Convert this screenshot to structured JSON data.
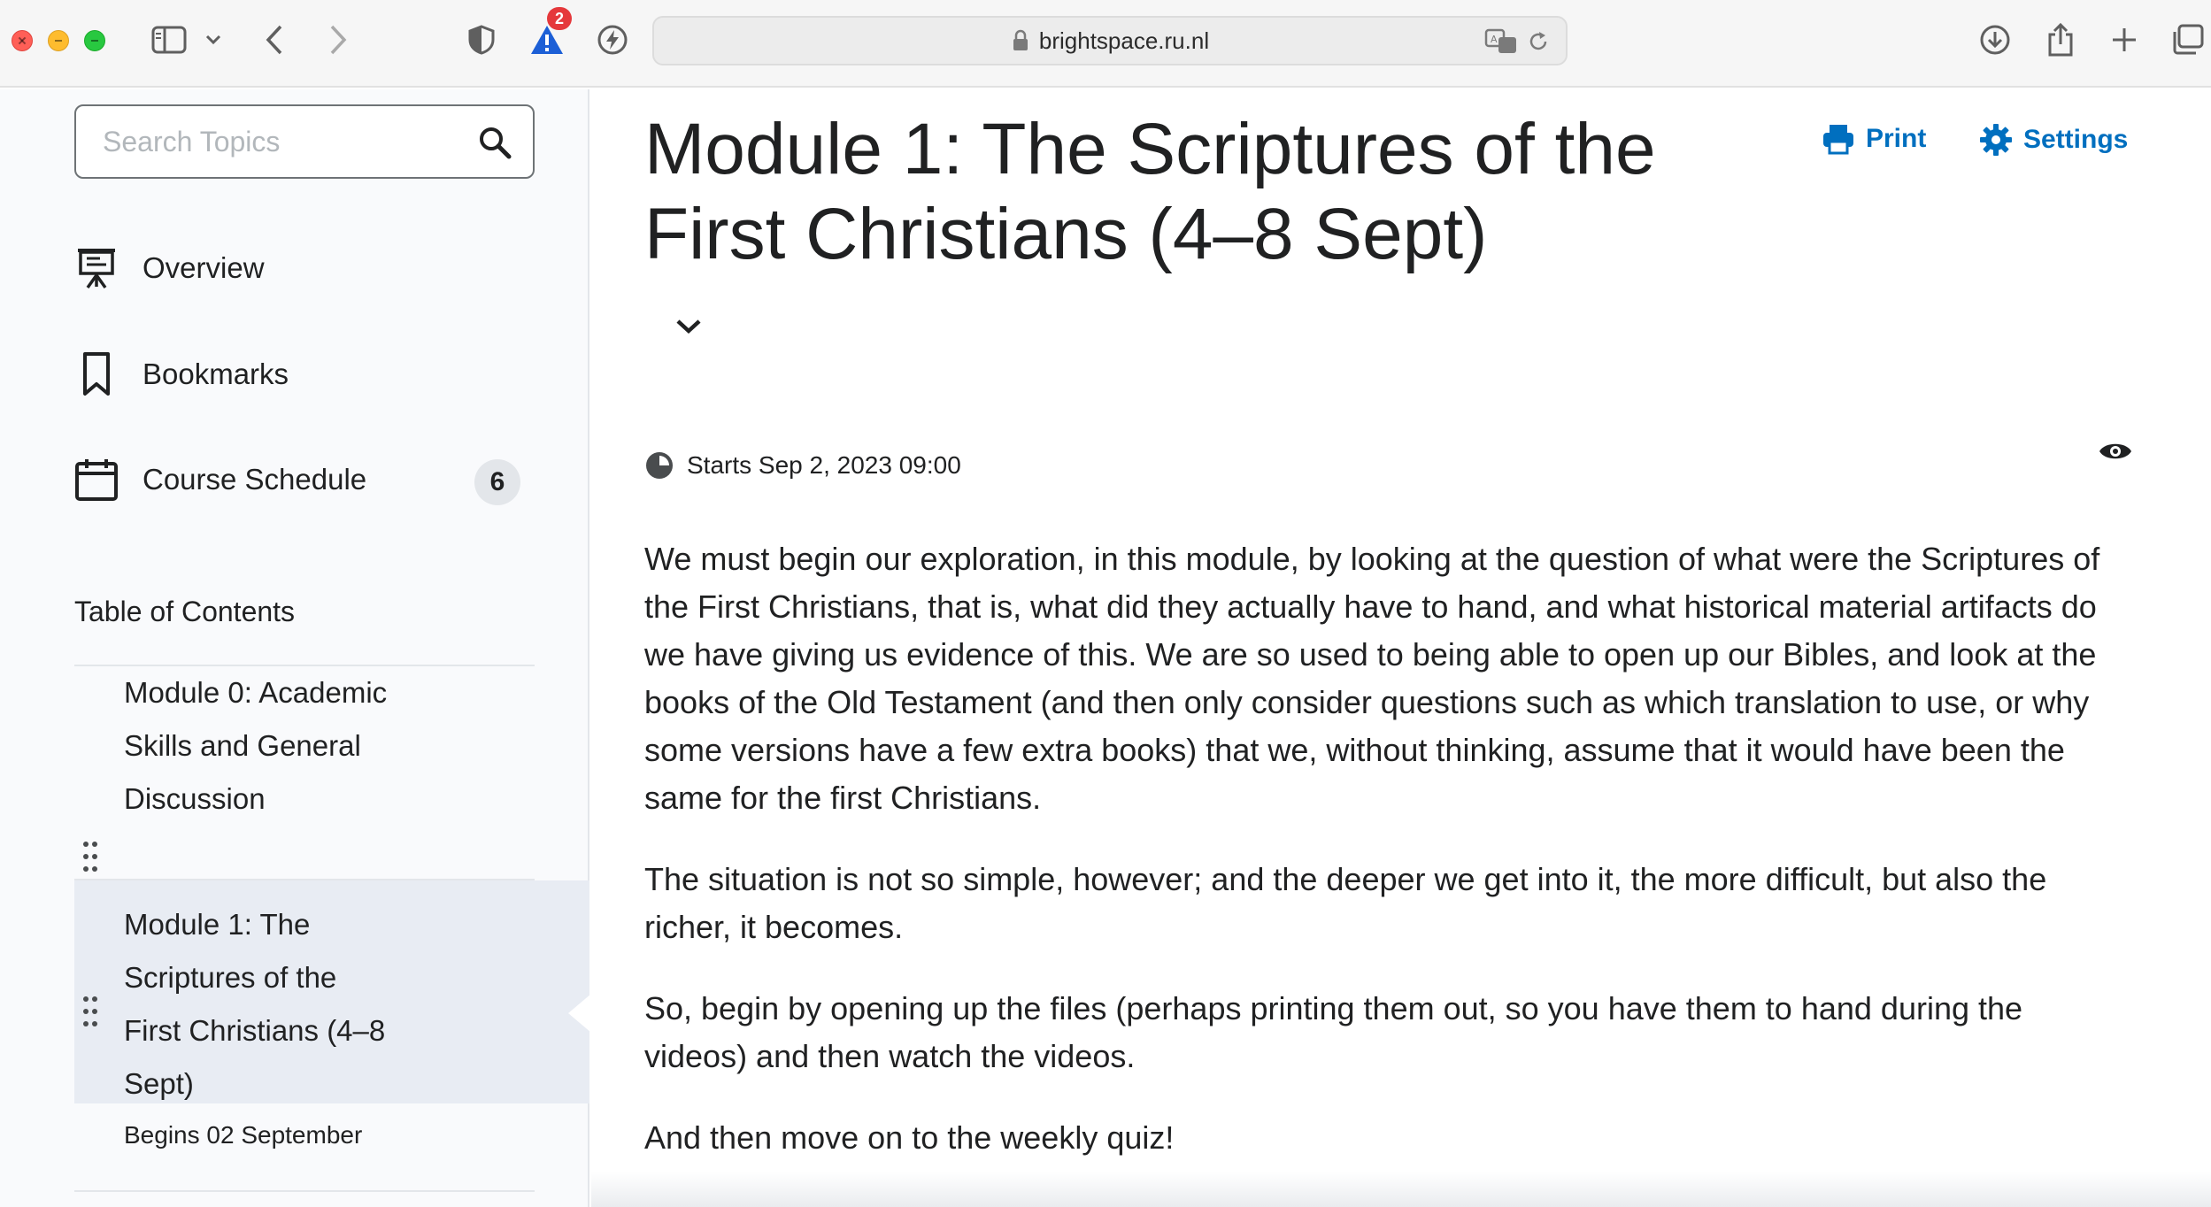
{
  "browser": {
    "url": "brightspace.ru.nl",
    "alert_badge_count": "2"
  },
  "sidebar": {
    "search_placeholder": "Search Topics",
    "nav": [
      {
        "label": "Overview",
        "icon": "presentation-icon"
      },
      {
        "label": "Bookmarks",
        "icon": "bookmark-icon"
      },
      {
        "label": "Course Schedule",
        "icon": "calendar-icon",
        "count": "6"
      }
    ],
    "toc_heading": "Table of Contents",
    "toc": [
      {
        "title_lines": [
          "Module 0: Academic",
          "Skills and General",
          "Discussion"
        ],
        "date": ""
      },
      {
        "title_lines": [
          "Module 1: The",
          "Scriptures of the",
          "First Christians (4–8",
          "Sept)"
        ],
        "date": "Begins 02 September",
        "active": true
      }
    ]
  },
  "main": {
    "title": "Module 1: The Scriptures of the First Christians (4–8 Sept)",
    "print_label": "Print",
    "settings_label": "Settings",
    "starts": "Starts Sep 2, 2023 09:00",
    "paragraphs": [
      "We must begin our exploration, in this module, by looking at the question of what were the Scriptures of the First Christians, that is, what did they actually have to hand, and what historical material artifacts do we have giving us evidence of this. We are so used to being able to open up our Bibles, and look at the books of the Old Testament (and then only consider questions such as which translation to use, or why some versions have a few extra books) that we, without thinking, assume that it would have been the same for the first Christians.",
      "The situation is not so simple, however; and the deeper we get into it, the more difficult, but also the richer, it becomes.",
      "So, begin by opening up the files (perhaps printing them out, so you have them to hand during the videos) and then watch the videos.",
      "And then move on to the weekly quiz!"
    ]
  },
  "colors": {
    "link": "#006fbf",
    "sidebar_bg": "#f9fafc",
    "active_bg": "#e8ecf3",
    "text": "#202122"
  }
}
